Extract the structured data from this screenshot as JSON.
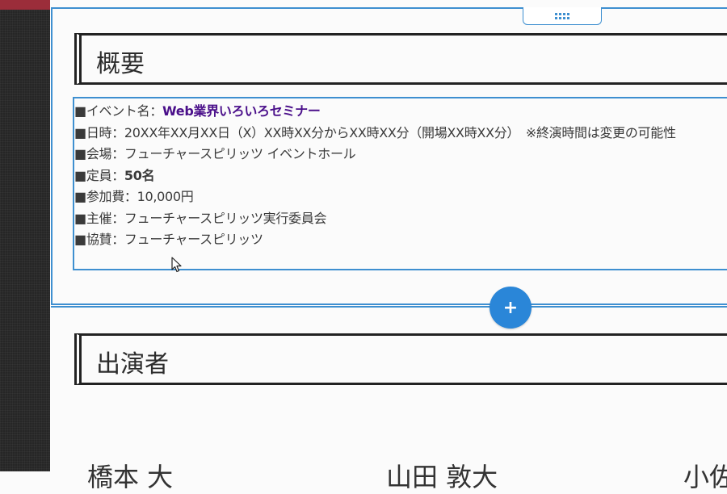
{
  "overview": {
    "heading": "概要",
    "rows": [
      {
        "label": "■イベント名：",
        "value": "Web業界いろいろセミナー",
        "style": "link"
      },
      {
        "label": "■日時：20XX年XX月XX日（X）XX時XX分からXX時XX分（開場XX時XX分）　※終演時間は変更の可能性",
        "value": "",
        "style": "plain"
      },
      {
        "label": "■会場：フューチャースピリッツ イベントホール",
        "value": "",
        "style": "plain"
      },
      {
        "label": "■定員：",
        "value": "50名",
        "style": "bold"
      },
      {
        "label": "■参加費：10,000円",
        "value": "",
        "style": "plain"
      },
      {
        "label": "■主催：フューチャースピリッツ実行委員会",
        "value": "",
        "style": "plain"
      },
      {
        "label": "■協賛：フューチャースピリッツ",
        "value": "",
        "style": "plain"
      }
    ]
  },
  "performers": {
    "heading": "出演者",
    "names_cutoff": [
      "橋本 大",
      "山田 敦大",
      "小佐"
    ]
  },
  "controls": {
    "add_symbol": "+"
  },
  "colors": {
    "accent": "#3e8fd0",
    "button": "#2a86d8",
    "link": "#4a0f8a"
  }
}
